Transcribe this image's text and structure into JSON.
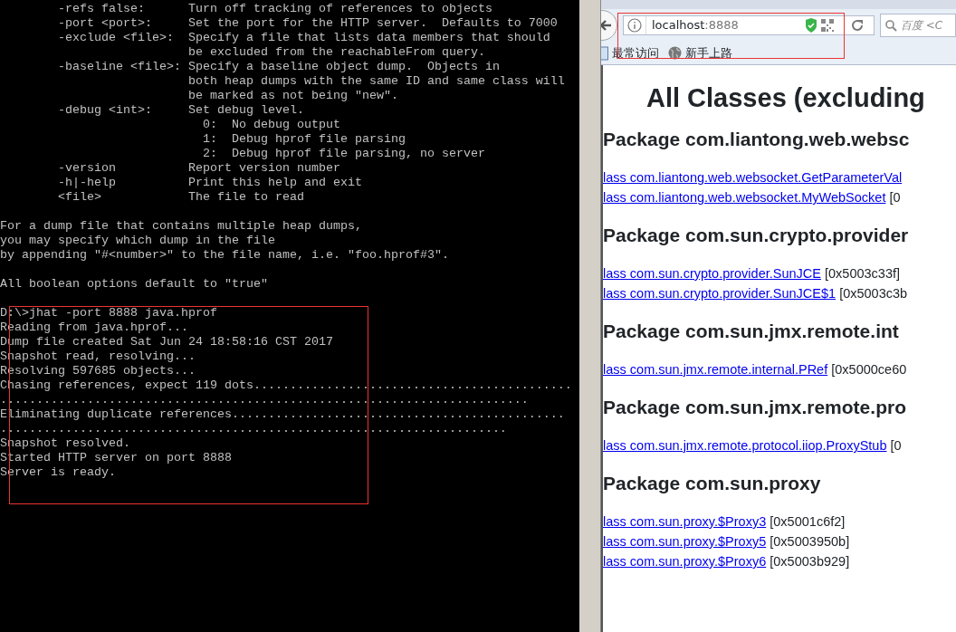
{
  "terminal": {
    "blocks": [
      [
        "        -refs false:      Turn off tracking of references to objects",
        "        -port <port>:     Set the port for the HTTP server.  Defaults to 7000",
        "        -exclude <file>:  Specify a file that lists data members that should",
        "                          be excluded from the reachableFrom query.",
        "        -baseline <file>: Specify a baseline object dump.  Objects in",
        "                          both heap dumps with the same ID and same class will",
        "                          be marked as not being \"new\".",
        "        -debug <int>:     Set debug level.",
        "                            0:  No debug output",
        "                            1:  Debug hprof file parsing",
        "                            2:  Debug hprof file parsing, no server",
        "        -version          Report version number",
        "        -h|-help          Print this help and exit",
        "        <file>            The file to read"
      ],
      [
        "For a dump file that contains multiple heap dumps,",
        "you may specify which dump in the file",
        "by appending \"#<number>\" to the file name, i.e. \"foo.hprof#3\"."
      ],
      [
        "All boolean options default to \"true\""
      ],
      [
        "D:\\>jhat -port 8888 java.hprof",
        "Reading from java.hprof...",
        "Dump file created Sat Jun 24 18:58:16 CST 2017",
        "Snapshot read, resolving...",
        "Resolving 597685 objects...",
        "Chasing references, expect 119 dots............................................",
        ".........................................................................",
        "Eliminating duplicate references..............................................",
        "......................................................................",
        "Snapshot resolved.",
        "Started HTTP server on port 8888",
        "Server is ready."
      ]
    ]
  },
  "browser": {
    "url_host": "localhost",
    "url_port": ":8888",
    "search_placeholder": "百度 <C",
    "bookmarks": [
      {
        "kind": "folder",
        "label": "最常访问"
      },
      {
        "kind": "globe",
        "label": "新手上路"
      }
    ],
    "page": {
      "title": "All Classes (excluding",
      "sections": [
        {
          "heading": "Package com.liantong.web.websc",
          "classes": [
            {
              "link": "lass com.liantong.web.websocket.GetParameterVal"
            },
            {
              "link": "lass com.liantong.web.websocket.MyWebSocket",
              "address": "[0"
            }
          ]
        },
        {
          "heading": "Package com.sun.crypto.provider",
          "classes": [
            {
              "link": "lass com.sun.crypto.provider.SunJCE",
              "address": "[0x5003c33f]"
            },
            {
              "link": "lass com.sun.crypto.provider.SunJCE$1",
              "address": "[0x5003c3b"
            }
          ]
        },
        {
          "heading": "Package com.sun.jmx.remote.int",
          "classes": [
            {
              "link": "lass com.sun.jmx.remote.internal.PRef",
              "address": "[0x5000ce60"
            }
          ]
        },
        {
          "heading": "Package com.sun.jmx.remote.pro",
          "classes": [
            {
              "link": "lass com.sun.jmx.remote.protocol.iiop.ProxyStub",
              "address": "[0"
            }
          ]
        },
        {
          "heading": "Package com.sun.proxy",
          "classes": [
            {
              "link": "lass com.sun.proxy.$Proxy3",
              "address": "[0x5001c6f2]"
            },
            {
              "link": "lass com.sun.proxy.$Proxy5",
              "address": "[0x5003950b]"
            },
            {
              "link": "lass com.sun.proxy.$Proxy6",
              "address": "[0x5003b929]"
            }
          ]
        }
      ]
    }
  }
}
